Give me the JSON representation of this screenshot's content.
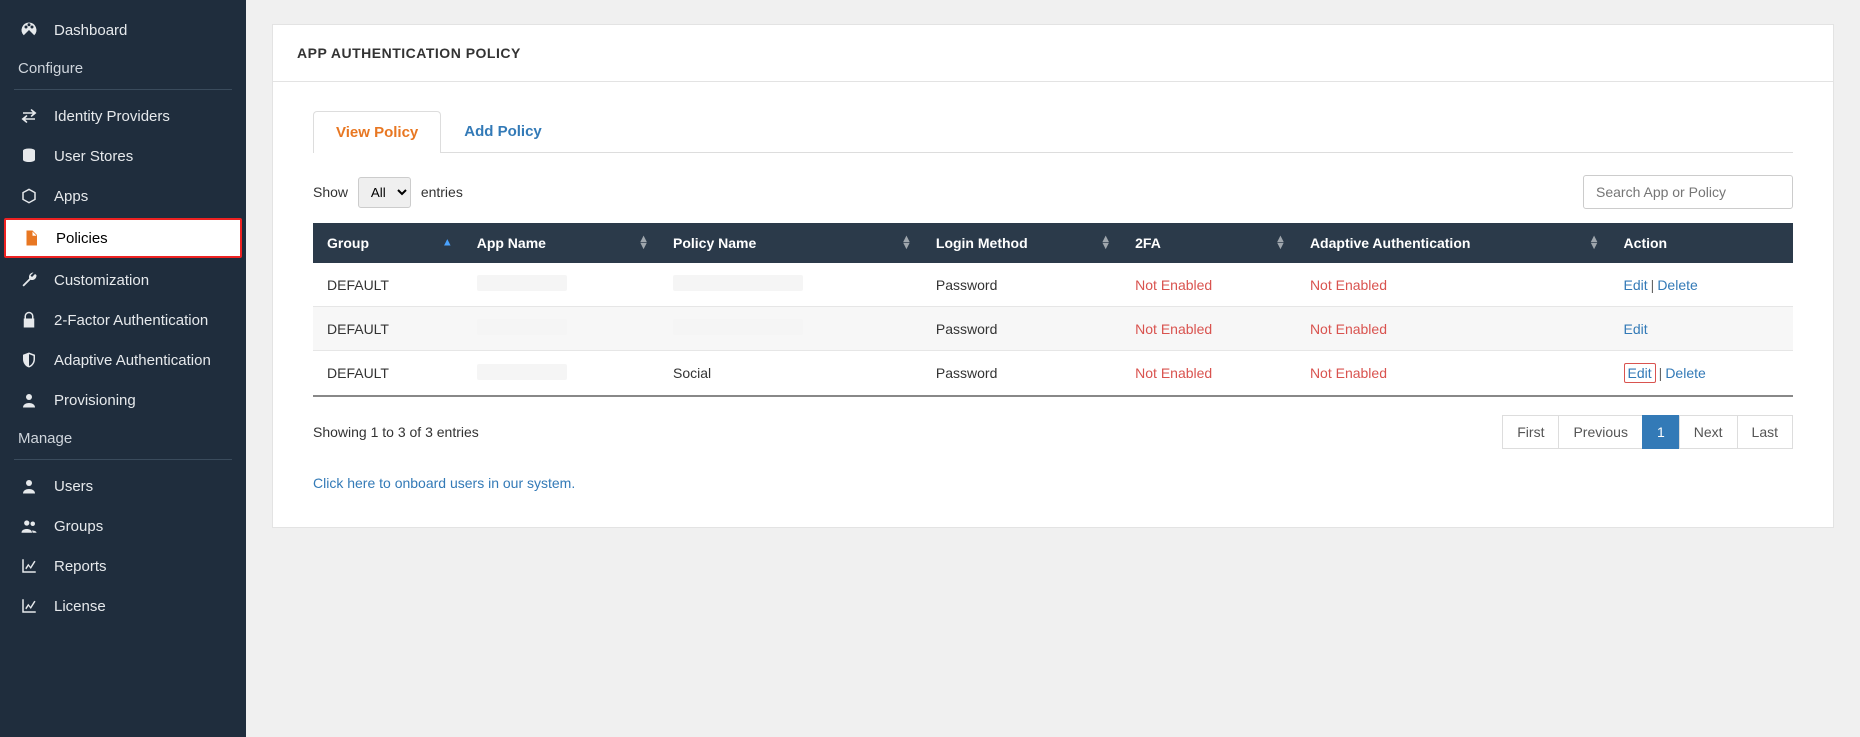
{
  "sidebar": {
    "items_top": [
      {
        "label": "Dashboard",
        "icon": "dashboard"
      }
    ],
    "section_configure": "Configure",
    "items_configure": [
      {
        "label": "Identity Providers",
        "icon": "swap"
      },
      {
        "label": "User Stores",
        "icon": "database"
      },
      {
        "label": "Apps",
        "icon": "cube"
      },
      {
        "label": "Policies",
        "icon": "file",
        "active": true
      },
      {
        "label": "Customization",
        "icon": "wrench"
      },
      {
        "label": "2-Factor Authentication",
        "icon": "lock"
      },
      {
        "label": "Adaptive Authentication",
        "icon": "shield"
      },
      {
        "label": "Provisioning",
        "icon": "user"
      }
    ],
    "section_manage": "Manage",
    "items_manage": [
      {
        "label": "Users",
        "icon": "user"
      },
      {
        "label": "Groups",
        "icon": "users"
      },
      {
        "label": "Reports",
        "icon": "chart"
      },
      {
        "label": "License",
        "icon": "chart"
      }
    ]
  },
  "header": {
    "title": "APP AUTHENTICATION POLICY"
  },
  "tabs": {
    "view": "View Policy",
    "add": "Add Policy"
  },
  "controls": {
    "show_label": "Show",
    "entries_label": "entries",
    "select_value": "All",
    "search_placeholder": "Search App or Policy"
  },
  "table": {
    "columns": {
      "group": "Group",
      "app": "App Name",
      "policy": "Policy Name",
      "login": "Login Method",
      "twofa": "2FA",
      "adaptive": "Adaptive Authentication",
      "action": "Action"
    },
    "rows": [
      {
        "group": "DEFAULT",
        "app": "",
        "policy": "",
        "login": "Password",
        "twofa": "Not Enabled",
        "adaptive": "Not Enabled",
        "actions": [
          "Edit",
          "Delete"
        ],
        "highlight": false
      },
      {
        "group": "DEFAULT",
        "app": "",
        "policy": "",
        "login": "Password",
        "twofa": "Not Enabled",
        "adaptive": "Not Enabled",
        "actions": [
          "Edit"
        ],
        "highlight": false
      },
      {
        "group": "DEFAULT",
        "app": "",
        "policy": "Social",
        "login": "Password",
        "twofa": "Not Enabled",
        "adaptive": "Not Enabled",
        "actions": [
          "Edit",
          "Delete"
        ],
        "highlight": true
      }
    ]
  },
  "footer": {
    "info": "Showing 1 to 3 of 3 entries",
    "pager": {
      "first": "First",
      "prev": "Previous",
      "page": "1",
      "next": "Next",
      "last": "Last"
    }
  },
  "onboard_link": "Click here to onboard users in our system."
}
